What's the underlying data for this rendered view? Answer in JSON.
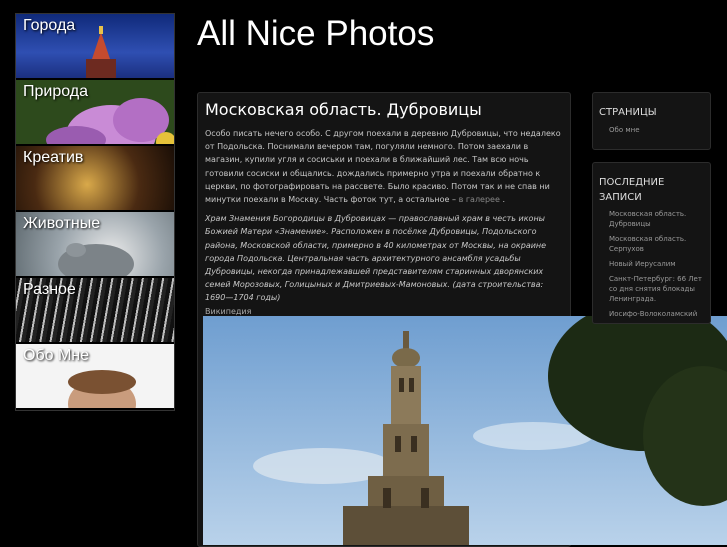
{
  "site": {
    "title": "All Nice Photos"
  },
  "nav": {
    "items": [
      {
        "label": "Города"
      },
      {
        "label": "Природа"
      },
      {
        "label": "Креатив"
      },
      {
        "label": "Животные"
      },
      {
        "label": "Разное"
      },
      {
        "label": "Обо Мне"
      }
    ]
  },
  "post": {
    "title": "Московская область. Дубровицы",
    "intro": "Особо писать нечего особо. С другом поехали в деревню Дубровицы, что недалеко от Подольска. Поснимали вечером там, погуляли немного. Потом заехали в магазин, купили угля и сосиськи и поехали в ближайший лес. Там всю ночь готовили сосиски и общались. дождались примерно   утра и поехали обратно к церкви, по фотографировать на рассвете. Было красиво. Потом так и не спав ни минутки поехали в Москву. Часть фоток тут, а остальное –",
    "gallery_link": "в галерее",
    "quote": "Храм Знамения Богородицы в Дубровицах — православный храм в честь иконы Божией Матери «Знамение». Расположен в посёлке Дубровицы, Подольского района, Московской области, примерно в 40 километрах от Москвы, на окраине города Подольска. Центральная часть архитектурного ансамбля усадьбы Дубровицы, некогда принадлежавшей представителям старинных дворянских семей Морозовых, Голицыных и Дмитриевых-Мамоновых. (дата строительства: 1690—1704 годы)",
    "source": "Википедия"
  },
  "sidebar": {
    "pages": {
      "heading": "СТРАНИЦЫ",
      "items": [
        "Обо мне"
      ]
    },
    "recent": {
      "heading": "ПОСЛЕДНИЕ ЗАПИСИ",
      "items": [
        "Московская область. Дубровицы",
        "Московская область. Серпухов",
        "Новый Иерусалим",
        "Санкт-Петербург: 66 Лет со дня снятия блокады Ленинграда.",
        "Иосифо-Волоколамский"
      ]
    }
  }
}
